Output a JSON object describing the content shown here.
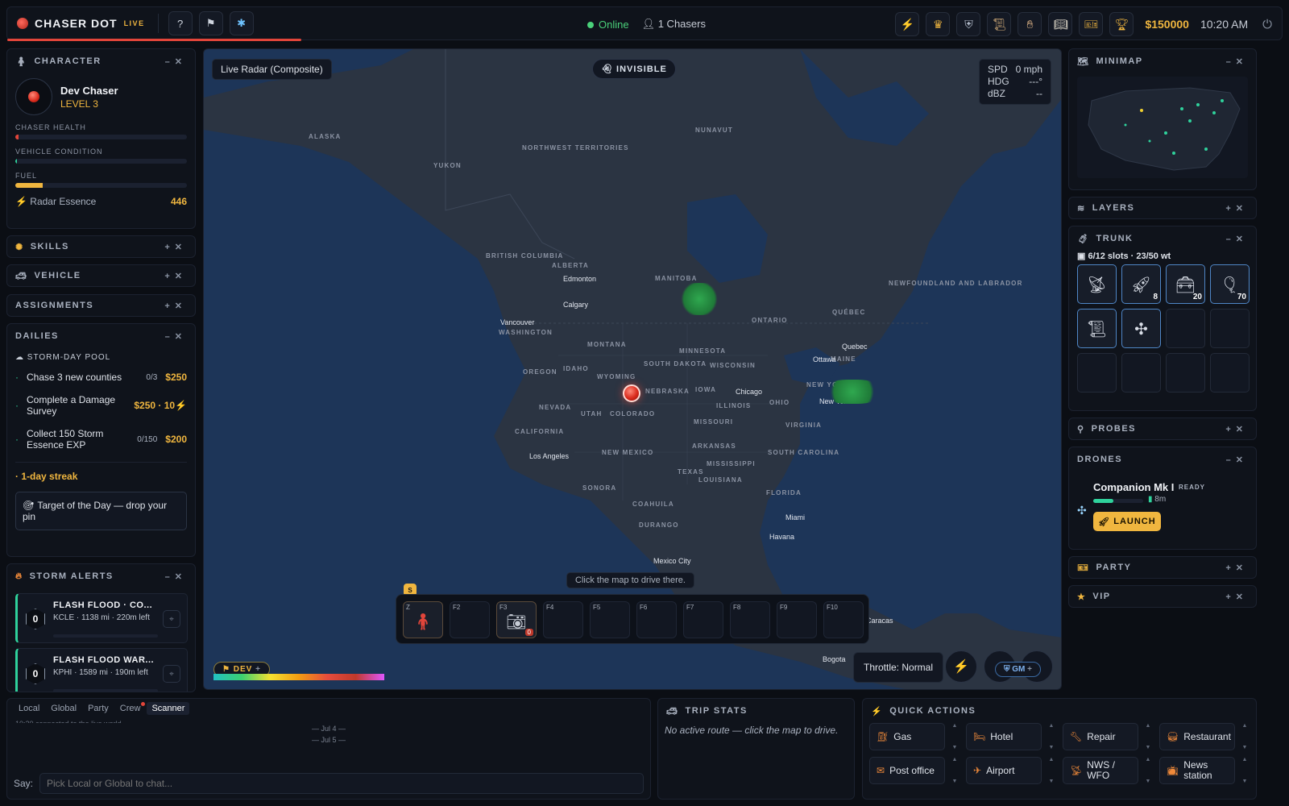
{
  "app": {
    "name": "CHASER DOT",
    "live": "LIVE"
  },
  "topbar": {
    "status": "Online",
    "chasers": "1 Chasers",
    "money": "$150000",
    "time": "10:20 AM",
    "buttons": [
      "help-icon",
      "flag-icon",
      "settings-icon"
    ],
    "tools": [
      "bolt-icon",
      "crown-icon",
      "shield-icon",
      "scroll-icon",
      "hand-icon",
      "book-icon",
      "ticket-icon",
      "trophy-icon"
    ]
  },
  "character": {
    "title": "CHARACTER",
    "name": "Dev Chaser",
    "level": "LEVEL 3",
    "health_label": "CHASER HEALTH",
    "health_value": 0.02,
    "vehicle_label": "VEHICLE CONDITION",
    "vehicle_value": 0.01,
    "fuel_label": "FUEL",
    "fuel_value": 0.16,
    "essence_label": "Radar Essence",
    "essence_value": "446"
  },
  "sections": {
    "skills": "SKILLS",
    "vehicle": "VEHICLE",
    "assignments": "ASSIGNMENTS",
    "dailies": "DAILIES",
    "storm_alerts": "STORM ALERTS"
  },
  "dailies": {
    "pool": "STORM-DAY POOL",
    "items": [
      {
        "label": "Chase 3 new counties",
        "progress": "0/3",
        "reward": "$250"
      },
      {
        "label": "Complete a Damage Survey",
        "progress": "",
        "reward": "$250 · 10⚡"
      },
      {
        "label": "Collect 150 Storm Essence EXP",
        "progress": "0/150",
        "reward": "$200"
      }
    ],
    "streak": "1-day streak",
    "target": "Target of the Day — drop your pin"
  },
  "alerts": [
    {
      "count": "0",
      "title": "FLASH FLOOD · CO...",
      "sub": "KCLE · 1138 mi · 220m left"
    },
    {
      "count": "0",
      "title": "FLASH FLOOD WAR...",
      "sub": "KPHI · 1589 mi · 190m left"
    }
  ],
  "map": {
    "radar_title": "Live Radar (Composite)",
    "invisible": "INVISIBLE",
    "spd_label": "SPD",
    "spd_value": "0 mph",
    "hdg_label": "HDG",
    "hdg_value": "---°",
    "dbz_label": "dBZ",
    "dbz_value": "--",
    "hint": "Click the map to drive there.",
    "throttle": "Throttle: Normal",
    "dev": "DEV",
    "gm": "GM",
    "s_badge": "S",
    "regions": [
      "ALASKA",
      "YUKON",
      "NORTHWEST TERRITORIES",
      "NUNAVUT",
      "BRITISH COLUMBIA",
      "ALBERTA",
      "MANITOBA",
      "ONTARIO",
      "QUÉBEC",
      "NEWFOUNDLAND AND LABRADOR",
      "WASHINGTON",
      "MONTANA",
      "MINNESOTA",
      "SOUTH DAKOTA",
      "WYOMING",
      "OREGON",
      "IDAHO",
      "NEBRASKA",
      "IOWA",
      "WISCONSIN",
      "NEVADA",
      "UTAH",
      "COLORADO",
      "ILLINOIS",
      "OHIO",
      "NEW YORK",
      "MAINE",
      "CALIFORNIA",
      "MISSOURI",
      "VIRGINIA",
      "NEW MEXICO",
      "ARKANSAS",
      "TEXAS",
      "SOUTH CAROLINA",
      "MISSISSIPPI",
      "LOUISIANA",
      "FLORIDA",
      "SONORA",
      "COAHUILA",
      "DURANGO"
    ],
    "cities": [
      "Edmonton",
      "Calgary",
      "Vancouver",
      "Ottawa",
      "Quebec",
      "Chicago",
      "New York",
      "Los Angeles",
      "Miami",
      "Havana",
      "Mexico City",
      "Caracas",
      "Bogota"
    ]
  },
  "hotbar": [
    {
      "key": "Z",
      "item": "chaser-figure-icon",
      "qty": ""
    },
    {
      "key": "F2",
      "item": "",
      "qty": ""
    },
    {
      "key": "F3",
      "item": "camera-icon",
      "qty": "0"
    },
    {
      "key": "F4",
      "item": "",
      "qty": ""
    },
    {
      "key": "F5",
      "item": "",
      "qty": ""
    },
    {
      "key": "F6",
      "item": "",
      "qty": ""
    },
    {
      "key": "F7",
      "item": "",
      "qty": ""
    },
    {
      "key": "F8",
      "item": "",
      "qty": ""
    },
    {
      "key": "F9",
      "item": "",
      "qty": ""
    },
    {
      "key": "F10",
      "item": "",
      "qty": ""
    }
  ],
  "right": {
    "minimap": "MINIMAP",
    "layers": "LAYERS",
    "trunk": "TRUNK",
    "trunk_info": "6/12 slots · 23/50 wt",
    "trunk_items": [
      {
        "icon": "radar-dish-icon",
        "qty": ""
      },
      {
        "icon": "rocket-probe-icon",
        "qty": "8"
      },
      {
        "icon": "toolbox-icon",
        "qty": "20"
      },
      {
        "icon": "weather-balloon-icon",
        "qty": "70"
      },
      {
        "icon": "map-scroll-icon",
        "qty": ""
      },
      {
        "icon": "drone-icon",
        "qty": ""
      }
    ],
    "probes": "PROBES",
    "drones": "DRONES",
    "drone_name": "Companion Mk I",
    "drone_status": "READY",
    "drone_battery": "8m",
    "drone_charge": 0.4,
    "launch": "LAUNCH",
    "party": "PARTY",
    "vip": "VIP"
  },
  "chat": {
    "tabs": [
      "Local",
      "Global",
      "Party",
      "Crew",
      "Scanner"
    ],
    "log": [
      "10:20 connected to the live world.",
      "— Jul 4 —",
      "— Jul 5 —"
    ],
    "say": "Say:",
    "placeholder": "Pick Local or Global to chat..."
  },
  "trip": {
    "title": "TRIP STATS",
    "empty": "No active route — click the map to drive."
  },
  "quick": {
    "title": "QUICK ACTIONS",
    "buttons": [
      "Gas",
      "Hotel",
      "Repair",
      "Restaurant",
      "Post office",
      "Airport",
      "NWS / WFO",
      "News station"
    ]
  }
}
